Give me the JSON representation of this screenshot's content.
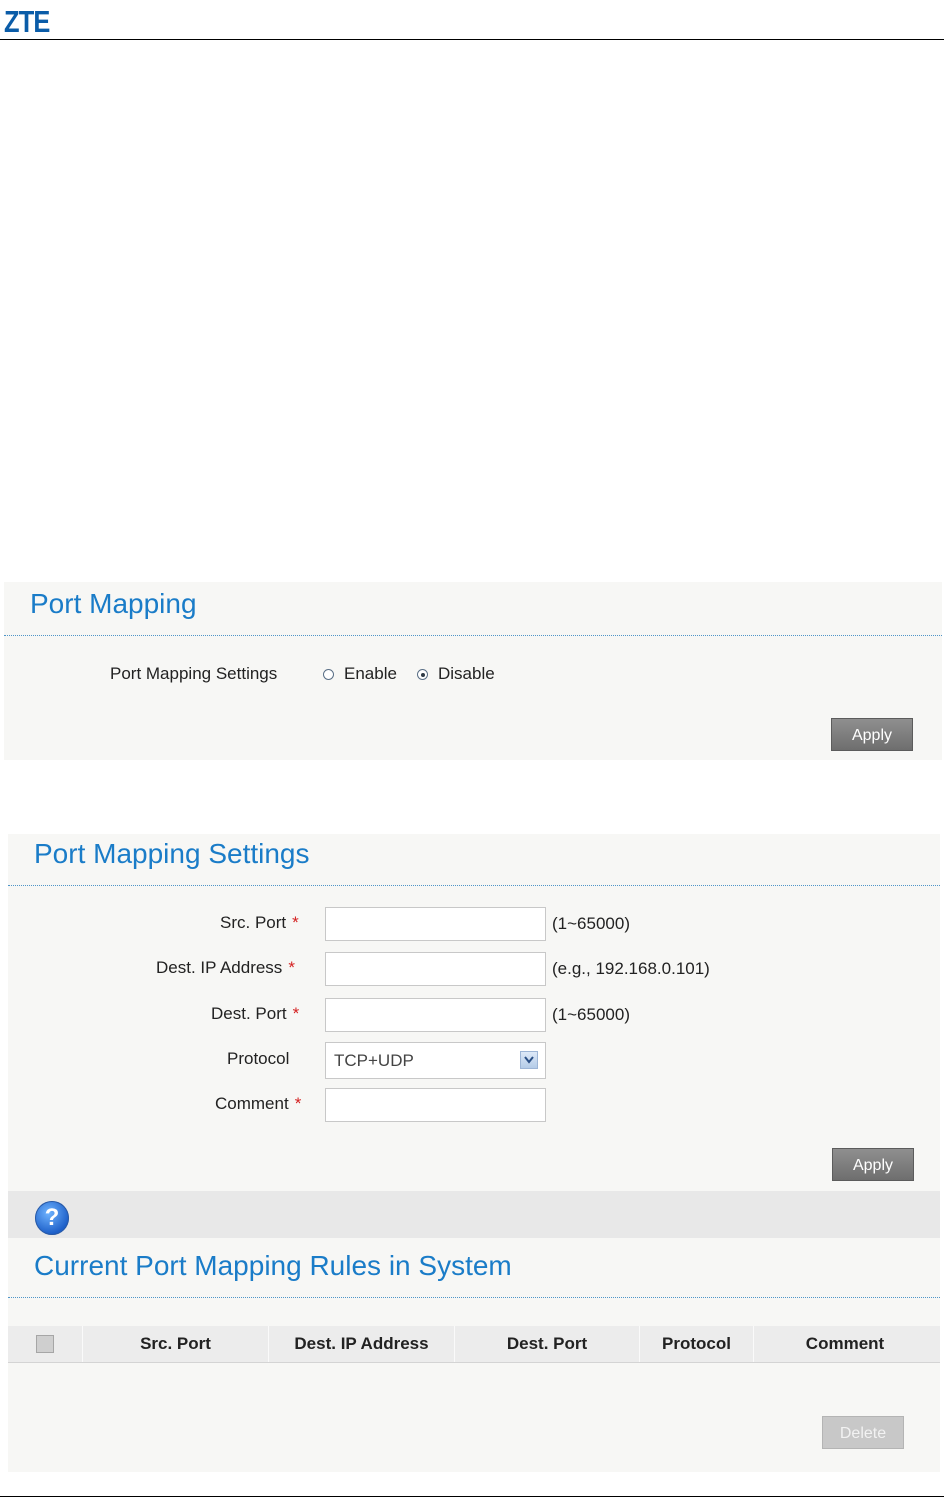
{
  "header": {
    "logo": "ZTE"
  },
  "port_mapping": {
    "title": "Port Mapping",
    "settings_label": "Port Mapping Settings",
    "options": [
      {
        "label": "Enable",
        "selected": false
      },
      {
        "label": "Disable",
        "selected": true
      }
    ],
    "apply_label": "Apply"
  },
  "settings_form": {
    "title": "Port Mapping Settings",
    "required_mark": "*",
    "src_port": {
      "label": "Src. Port",
      "value": "",
      "hint": "(1~65000)"
    },
    "dest_ip": {
      "label": "Dest. IP Address",
      "value": "",
      "hint": "(e.g., 192.168.0.101)"
    },
    "dest_port": {
      "label": "Dest. Port",
      "value": "",
      "hint": "(1~65000)"
    },
    "protocol": {
      "label": "Protocol",
      "value": "TCP+UDP"
    },
    "comment": {
      "label": "Comment",
      "value": ""
    },
    "apply_label": "Apply"
  },
  "help": {
    "icon": "help-icon",
    "glyph": "?"
  },
  "rules": {
    "title": "Current Port Mapping Rules in System",
    "columns": [
      "Src. Port",
      "Dest. IP Address",
      "Dest. Port",
      "Protocol",
      "Comment"
    ],
    "rows": [],
    "delete_label": "Delete"
  },
  "colors": {
    "accent": "#1a7cc8",
    "logo": "#0a5ca8",
    "required": "#d42020",
    "button": "#7d7d7d"
  }
}
